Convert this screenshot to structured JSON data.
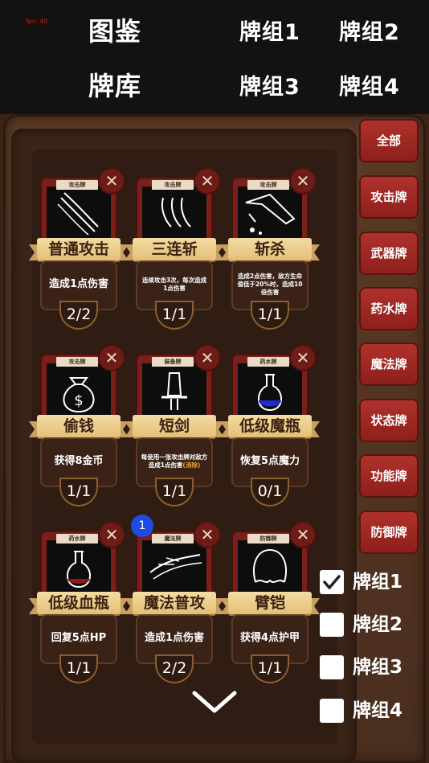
{
  "fps": "fps: 40",
  "top_nav": {
    "codex": "图鉴",
    "library": "牌库",
    "deck1": "牌组1",
    "deck2": "牌组2",
    "deck3": "牌组3",
    "deck4": "牌组4"
  },
  "filters": [
    "全部",
    "攻击牌",
    "武器牌",
    "药水牌",
    "魔法牌",
    "状态牌",
    "功能牌",
    "防御牌"
  ],
  "cards": [
    {
      "type": "攻击牌",
      "name": "普通攻击",
      "desc": "造成1点伤害",
      "desc_small": false,
      "count": "2/2",
      "icon": "slash-icon"
    },
    {
      "type": "攻击牌",
      "name": "三连斩",
      "desc": "连续攻击3次，每次造成1点伤害",
      "desc_small": true,
      "count": "1/1",
      "icon": "triple-slash-icon"
    },
    {
      "type": "攻击牌",
      "name": "斩杀",
      "desc": "造成2点伤害，敌方生命值低于20%时，造成10倍伤害",
      "desc_small": true,
      "count": "1/1",
      "icon": "blade-icon"
    },
    {
      "type": "攻击牌",
      "name": "偷钱",
      "desc": "获得8金币",
      "desc_small": false,
      "count": "1/1",
      "icon": "money-bag-icon"
    },
    {
      "type": "装备牌",
      "name": "短剑",
      "desc": "每使用一张攻击牌对敌方造成1点伤害",
      "desc_highlight": "(消除)",
      "desc_small": true,
      "count": "1/1",
      "icon": "short-sword-icon"
    },
    {
      "type": "药水牌",
      "name": "低级魔瓶",
      "desc": "恢复5点魔力",
      "desc_small": false,
      "count": "0/1",
      "icon": "mana-flask-icon"
    },
    {
      "type": "药水牌",
      "name": "低级血瓶",
      "desc": "回复5点HP",
      "desc_small": false,
      "count": "1/1",
      "icon": "health-flask-icon"
    },
    {
      "type": "魔法牌",
      "name": "魔法普攻",
      "desc": "造成1点伤害",
      "desc_small": false,
      "count": "2/2",
      "icon": "magic-strike-icon",
      "badge": "1"
    },
    {
      "type": "防御牌",
      "name": "臂铠",
      "desc": "获得4点护甲",
      "desc_small": false,
      "count": "1/1",
      "icon": "armguard-icon"
    }
  ],
  "deck_checks": [
    {
      "label": "牌组1",
      "checked": true
    },
    {
      "label": "牌组2",
      "checked": false
    },
    {
      "label": "牌组3",
      "checked": false
    },
    {
      "label": "牌组4",
      "checked": false
    }
  ],
  "colors": {
    "accent_red": "#a8302a",
    "ribbon_gold": "#e9c987",
    "panel_brown": "#3a2418",
    "badge_blue": "#1f4be0"
  }
}
